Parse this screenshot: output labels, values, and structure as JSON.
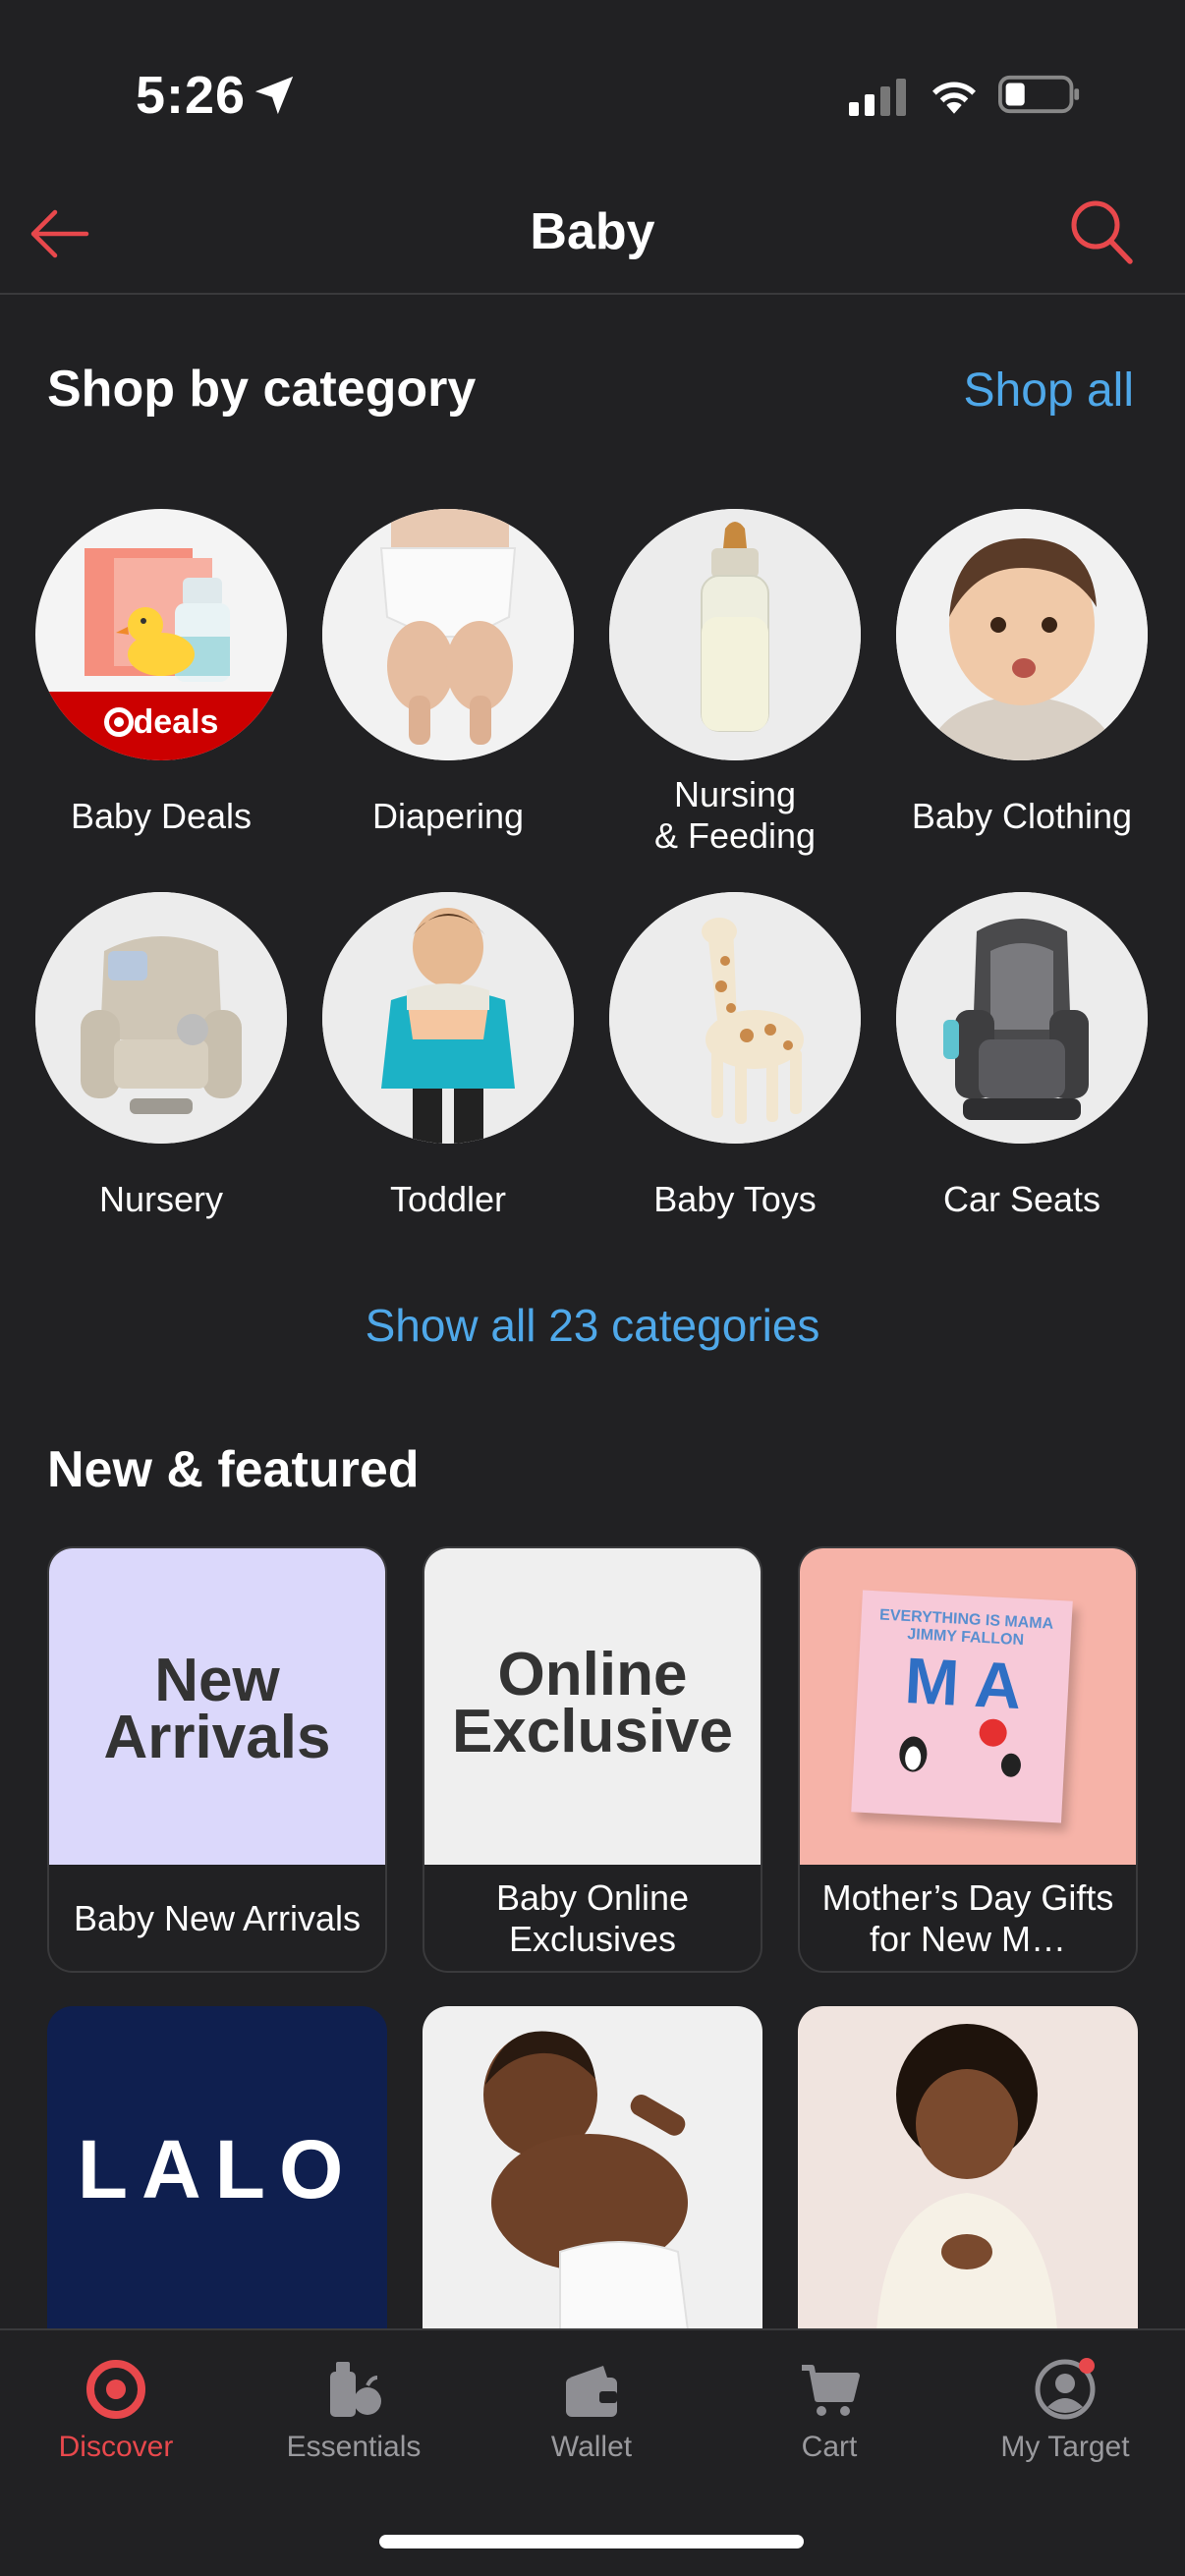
{
  "status": {
    "time": "5:26"
  },
  "header": {
    "title": "Baby"
  },
  "shop_by_category": {
    "title": "Shop by category",
    "shop_all": "Shop all",
    "deals_badge": "deals",
    "categories": [
      {
        "label": "Baby Deals"
      },
      {
        "label": "Diapering"
      },
      {
        "label": "Nursing\n& Feeding"
      },
      {
        "label": "Baby Clothing"
      },
      {
        "label": "Nursery"
      },
      {
        "label": "Toddler"
      },
      {
        "label": "Baby Toys"
      },
      {
        "label": "Car Seats"
      }
    ],
    "show_all": "Show all 23 categories"
  },
  "new_featured": {
    "title": "New & featured",
    "cards": [
      {
        "image_text": "New\nArrivals",
        "label": "Baby New Arrivals"
      },
      {
        "image_text": "Online\nExclusive",
        "label": "Baby Online Exclusives"
      },
      {
        "image_text": "EVERYTHING IS MAMA JIMMY FALLON",
        "label": "Mother’s Day Gifts for New M…"
      }
    ],
    "row2": [
      {
        "image_text": "LALO"
      },
      {
        "image_text": ""
      },
      {
        "image_text": ""
      }
    ]
  },
  "tabbar": {
    "tabs": [
      {
        "label": "Discover",
        "icon": "target-icon",
        "active": true
      },
      {
        "label": "Essentials",
        "icon": "essentials-icon"
      },
      {
        "label": "Wallet",
        "icon": "wallet-icon"
      },
      {
        "label": "Cart",
        "icon": "cart-icon"
      },
      {
        "label": "My Target",
        "icon": "profile-icon"
      }
    ]
  },
  "colors": {
    "accent": "#e8484c",
    "link": "#4fa8e9",
    "background": "#212123"
  }
}
